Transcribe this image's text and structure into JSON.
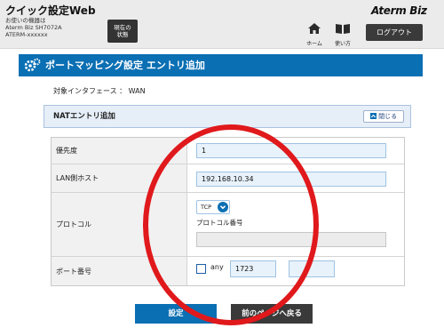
{
  "header": {
    "app_title": "クイック設定Web",
    "device_line1": "お使いの機器は",
    "device_line2": "Aterm Biz SH7072A",
    "device_line3": "ATERM-xxxxxx",
    "status_line1": "現在の",
    "status_line2": "状態",
    "brand": "Aterm Biz",
    "home_label": "ホーム",
    "help_label": "使い方",
    "logout_label": "ログアウト"
  },
  "page": {
    "title": "ポートマッピング設定 エントリ追加",
    "interface_text": "対象インタフェース ： WAN"
  },
  "section": {
    "title": "NATエントリ追加",
    "close_label": "閉じる"
  },
  "form": {
    "priority": {
      "label": "優先度",
      "value": "1"
    },
    "lan_host": {
      "label": "LAN側ホスト",
      "value": "192.168.10.34"
    },
    "protocol": {
      "label": "プロトコル",
      "selected": "TCP",
      "number_label": "プロトコル番号",
      "number_value": ""
    },
    "port": {
      "label": "ポート番号",
      "any_label": "any",
      "any_checked": false,
      "start": "1723",
      "separator": "-",
      "end": ""
    }
  },
  "buttons": {
    "submit": "設定",
    "back": "前のページへ戻る"
  },
  "colors": {
    "primary": "#0a6fb3",
    "dark_button": "#3a3a3a",
    "highlight": "#e0191c"
  }
}
